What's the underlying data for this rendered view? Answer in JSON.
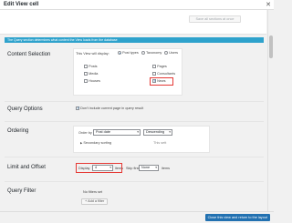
{
  "window": {
    "title": "Edit View cell"
  },
  "toolbar": {
    "save_all": "Save all sections at once"
  },
  "banner": {
    "text": "The Query section determines what content the View loads from the database"
  },
  "content_selection": {
    "label": "Content Selection",
    "display_label": "This View will display:",
    "modes": [
      "Post types",
      "Taxonomy",
      "Users"
    ],
    "post_types": [
      {
        "label": "Posts",
        "checked": false
      },
      {
        "label": "Pages",
        "checked": false
      },
      {
        "label": "Media",
        "checked": false
      },
      {
        "label": "Consultants",
        "checked": false
      },
      {
        "label": "Houses",
        "checked": false
      },
      {
        "label": "News",
        "checked": true
      }
    ]
  },
  "query_options": {
    "label": "Query Options",
    "option": "Don't include current page in query result"
  },
  "ordering": {
    "label": "Ordering",
    "order_by": "Order by",
    "field": "Post date",
    "direction": "Descending",
    "secondary": "Secondary sorting",
    "hint": "This sett"
  },
  "limit": {
    "label": "Limit and Offset",
    "display": "Display",
    "display_value": "4",
    "items": "items",
    "skip_first": "Skip first",
    "skip_value": "None",
    "items2": "items"
  },
  "query_filter": {
    "label": "Query Filter",
    "no_filters": "No filters set",
    "add_filter": "Add a filter"
  },
  "footer": {
    "close_button": "Close this view and return to the layout"
  },
  "colors": {
    "accent": "#2271b1",
    "banner": "#2ea2cc",
    "highlight": "#e53935"
  }
}
